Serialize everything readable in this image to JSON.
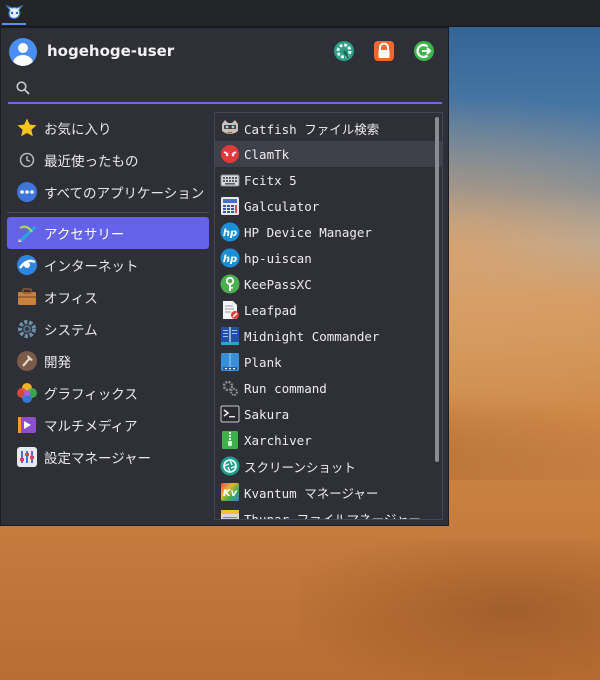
{
  "panel": {
    "launcher_icon": "whisker-cat-icon"
  },
  "header": {
    "username": "hogehoge-user",
    "buttons": [
      {
        "icon": "settings-icon"
      },
      {
        "icon": "lock-icon"
      },
      {
        "icon": "logout-icon"
      }
    ]
  },
  "search": {
    "value": "",
    "placeholder": ""
  },
  "categories": {
    "top": [
      {
        "label": "お気に入り",
        "icon": "star-icon"
      },
      {
        "label": "最近使ったもの",
        "icon": "clock-icon"
      },
      {
        "label": "すべてのアプリケーション",
        "icon": "all-apps-icon"
      }
    ],
    "items": [
      {
        "label": "アクセサリー",
        "icon": "accessories-icon",
        "active": true
      },
      {
        "label": "インターネット",
        "icon": "internet-icon"
      },
      {
        "label": "オフィス",
        "icon": "office-icon"
      },
      {
        "label": "システム",
        "icon": "system-icon"
      },
      {
        "label": "開発",
        "icon": "development-icon"
      },
      {
        "label": "グラフィックス",
        "icon": "graphics-icon"
      },
      {
        "label": "マルチメディア",
        "icon": "multimedia-icon"
      },
      {
        "label": "設定マネージャー",
        "icon": "settings-manager-icon"
      }
    ]
  },
  "apps": [
    {
      "label": "Catfish ファイル検索",
      "icon": "catfish-icon"
    },
    {
      "label": "ClamTk",
      "icon": "clamtk-icon"
    },
    {
      "label": "Fcitx 5",
      "icon": "keyboard-icon"
    },
    {
      "label": "Galculator",
      "icon": "calculator-icon"
    },
    {
      "label": "HP Device Manager",
      "icon": "hp-icon"
    },
    {
      "label": "hp-uiscan",
      "icon": "hp-icon"
    },
    {
      "label": "KeePassXC",
      "icon": "keepassxc-icon"
    },
    {
      "label": "Leafpad",
      "icon": "leafpad-icon"
    },
    {
      "label": "Midnight Commander",
      "icon": "midnight-commander-icon"
    },
    {
      "label": "Plank",
      "icon": "plank-icon"
    },
    {
      "label": "Run command",
      "icon": "run-command-icon"
    },
    {
      "label": "Sakura",
      "icon": "terminal-icon"
    },
    {
      "label": "Xarchiver",
      "icon": "archive-icon"
    },
    {
      "label": "スクリーンショット",
      "icon": "screenshot-icon"
    },
    {
      "label": "Kvantum マネージャー",
      "icon": "kvantum-icon"
    },
    {
      "label": "Thunar ファイルマネージャー",
      "icon": "file-manager-icon"
    }
  ],
  "colors": {
    "menu_bg": "#2e2f37",
    "accent": "#6462e8",
    "hover": "#3f4049"
  }
}
